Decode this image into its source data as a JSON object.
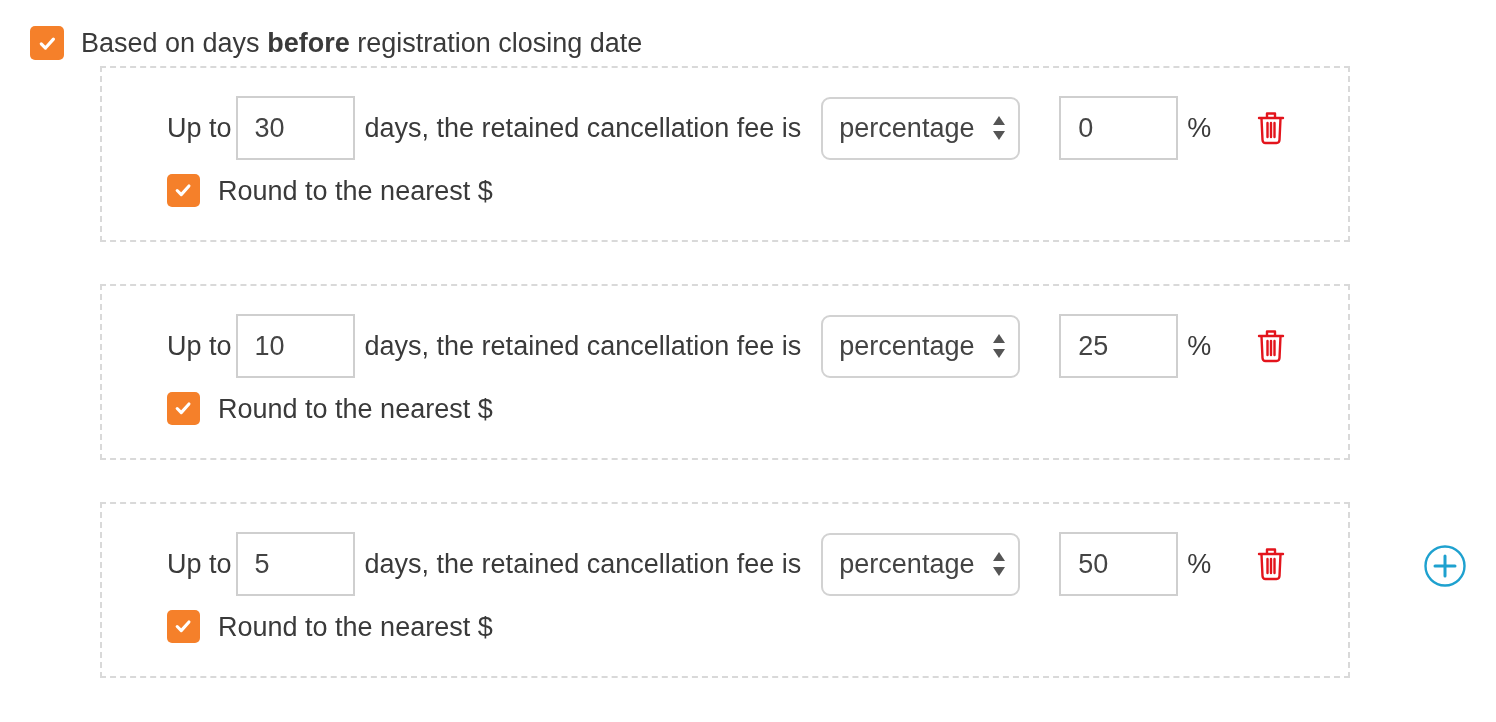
{
  "criterion": {
    "checked": true,
    "label": "Based on days **before** registration closing date"
  },
  "rules": [
    {
      "prefix": "Up to",
      "days": "30",
      "middle": "days, the retained cancellation fee is",
      "fee_type": "percentage",
      "amount": "0",
      "unit": "%",
      "round": {
        "checked": true,
        "label": "Round to the nearest $"
      }
    },
    {
      "prefix": "Up to",
      "days": "10",
      "middle": "days, the retained cancellation fee is",
      "fee_type": "percentage",
      "amount": "25",
      "unit": "%",
      "round": {
        "checked": true,
        "label": "Round to the nearest $"
      }
    },
    {
      "prefix": "Up to",
      "days": "5",
      "middle": "days, the retained cancellation fee is",
      "fee_type": "percentage",
      "amount": "50",
      "unit": "%",
      "round": {
        "checked": true,
        "label": "Round to the nearest $"
      }
    }
  ]
}
